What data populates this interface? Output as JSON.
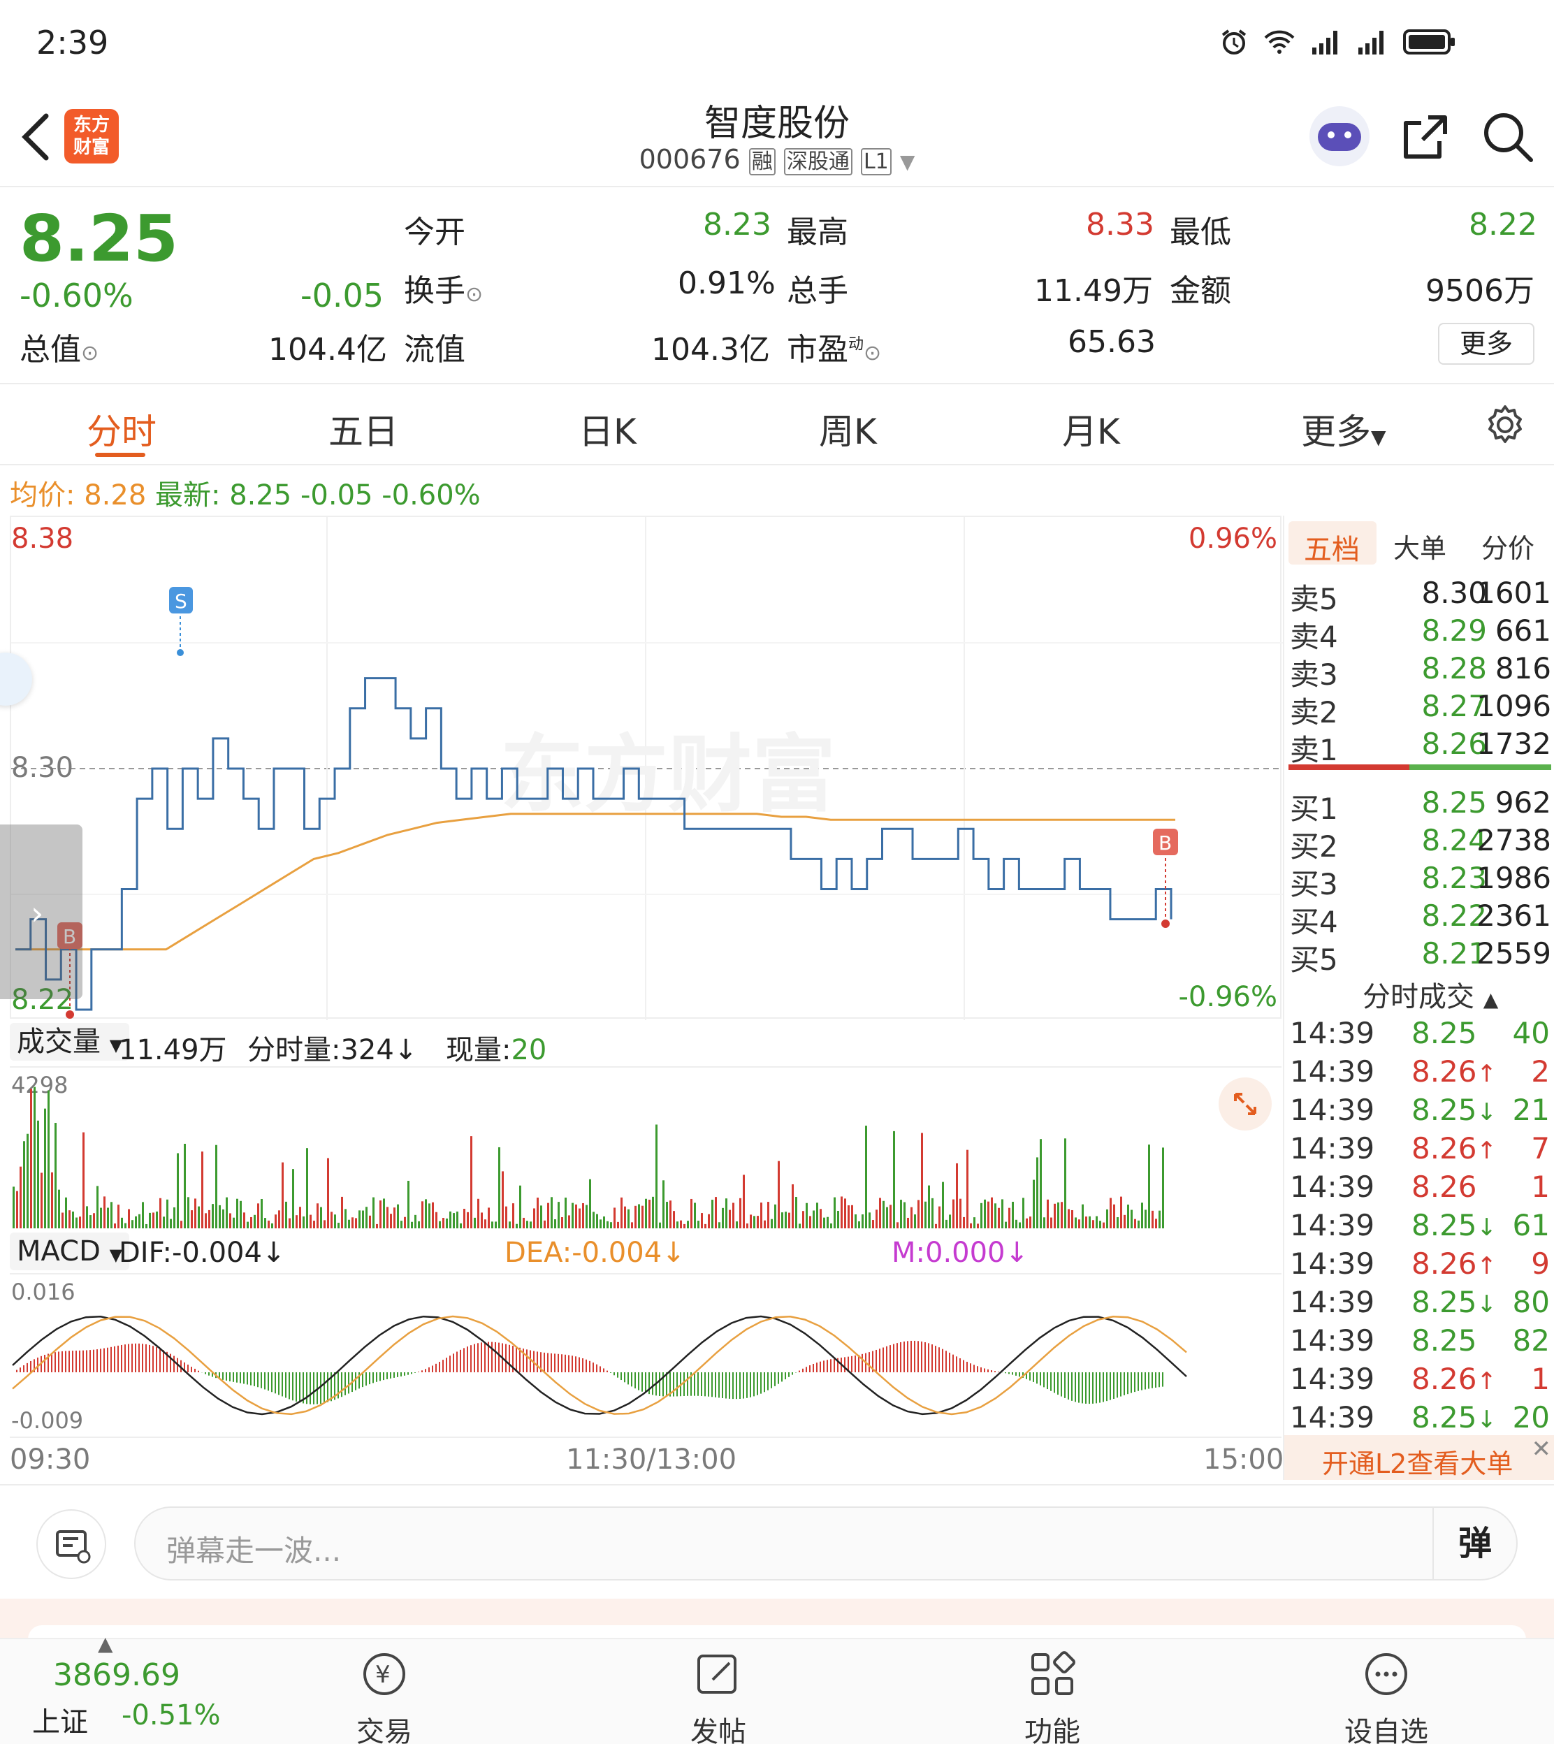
{
  "status": {
    "time": "2:39",
    "icons": [
      "alarm-icon",
      "wifi-icon",
      "signal-icon",
      "signal-icon",
      "battery-icon"
    ]
  },
  "header": {
    "title": "智度股份",
    "code": "000676",
    "tags": [
      "融",
      "深股通",
      "L1"
    ],
    "logo_text": "东方财富"
  },
  "quote": {
    "price": "8.25",
    "change_pct": "-0.60%",
    "change": "-0.05",
    "open_label": "今开",
    "open": "8.23",
    "high_label": "最高",
    "high": "8.33",
    "low_label": "最低",
    "low": "8.22",
    "turnover_label": "换手",
    "turnover": "0.91%",
    "volume_label": "总手",
    "volume": "11.49万",
    "amount_label": "金额",
    "amount": "9506万",
    "mktcap_label": "总值",
    "mktcap": "104.4亿",
    "float_label": "流值",
    "float": "104.3亿",
    "pe_label": "市盈",
    "pe_sup": "动",
    "pe": "65.63",
    "more_label": "更多"
  },
  "tabs": [
    "分时",
    "五日",
    "日K",
    "周K",
    "月K",
    "更多"
  ],
  "chart_info": {
    "avg_label": "均价:",
    "avg": "8.28",
    "latest_label": "最新:",
    "latest": "8.25",
    "change": "-0.05",
    "change_pct": "-0.60%",
    "watermark": "东方财富"
  },
  "chart_data": {
    "type": "line",
    "y_top": "8.38",
    "y_mid": "8.30",
    "y_bottom": "8.22",
    "pct_top": "0.96%",
    "pct_bottom": "-0.96%",
    "x_labels": [
      "09:30",
      "11:30/13:00",
      "15:00"
    ],
    "ylim": [
      8.22,
      8.38
    ],
    "price_series": [
      8.24,
      8.25,
      8.23,
      8.24,
      8.22,
      8.24,
      8.24,
      8.26,
      8.29,
      8.3,
      8.28,
      8.3,
      8.29,
      8.31,
      8.3,
      8.29,
      8.28,
      8.3,
      8.3,
      8.28,
      8.29,
      8.3,
      8.32,
      8.33,
      8.33,
      8.32,
      8.31,
      8.32,
      8.3,
      8.29,
      8.3,
      8.29,
      8.3,
      8.29,
      8.29,
      8.3,
      8.29,
      8.3,
      8.29,
      8.29,
      8.3,
      8.29,
      8.29,
      8.29,
      8.28,
      8.28,
      8.28,
      8.28,
      8.28,
      8.28,
      8.28,
      8.27,
      8.27,
      8.26,
      8.27,
      8.26,
      8.27,
      8.28,
      8.28,
      8.27,
      8.27,
      8.27,
      8.28,
      8.27,
      8.26,
      8.27,
      8.26,
      8.26,
      8.26,
      8.27,
      8.26,
      8.26,
      8.25,
      8.25,
      8.25,
      8.26,
      8.25
    ],
    "avg_series": [
      8.24,
      8.24,
      8.24,
      8.24,
      8.245,
      8.25,
      8.255,
      8.26,
      8.265,
      8.27,
      8.272,
      8.275,
      8.278,
      8.28,
      8.282,
      8.283,
      8.284,
      8.285,
      8.285,
      8.285,
      8.285,
      8.285,
      8.285,
      8.285,
      8.285,
      8.285,
      8.285,
      8.285,
      8.284,
      8.284,
      8.283,
      8.283,
      8.283,
      8.283,
      8.283,
      8.283,
      8.283,
      8.283,
      8.283,
      8.283,
      8.283,
      8.283,
      8.283,
      8.283,
      8.283
    ],
    "markers": [
      "S",
      "B",
      "B"
    ],
    "volume": {
      "label": "成交量",
      "total": "11.49万",
      "tick_label": "分时量:324",
      "current_label": "现量:",
      "current": "20",
      "max": "4298"
    },
    "macd": {
      "label": "MACD",
      "dif": "DIF:-0.004",
      "dea": "DEA:-0.004",
      "m": "M:0.000",
      "ymax": "0.016",
      "ymin": "-0.009"
    }
  },
  "orderbook": {
    "tabs": [
      "五档",
      "大单",
      "分价"
    ],
    "asks": [
      {
        "label": "卖5",
        "price": "8.30",
        "qty": "1601"
      },
      {
        "label": "卖4",
        "price": "8.29",
        "qty": "661"
      },
      {
        "label": "卖3",
        "price": "8.28",
        "qty": "816"
      },
      {
        "label": "卖2",
        "price": "8.27",
        "qty": "1096"
      },
      {
        "label": "卖1",
        "price": "8.26",
        "qty": "1732"
      }
    ],
    "bids": [
      {
        "label": "买1",
        "price": "8.25",
        "qty": "962"
      },
      {
        "label": "买2",
        "price": "8.24",
        "qty": "2738"
      },
      {
        "label": "买3",
        "price": "8.23",
        "qty": "1986"
      },
      {
        "label": "买4",
        "price": "8.22",
        "qty": "2361"
      },
      {
        "label": "买5",
        "price": "8.21",
        "qty": "2559"
      }
    ],
    "ticks_title": "分时成交",
    "ticks": [
      {
        "time": "14:39",
        "price": "8.25",
        "dir": "",
        "qty": "40",
        "color": "green"
      },
      {
        "time": "14:39",
        "price": "8.26",
        "dir": "↑",
        "qty": "2",
        "color": "red"
      },
      {
        "time": "14:39",
        "price": "8.25",
        "dir": "↓",
        "qty": "21",
        "color": "green"
      },
      {
        "time": "14:39",
        "price": "8.26",
        "dir": "↑",
        "qty": "7",
        "color": "red"
      },
      {
        "time": "14:39",
        "price": "8.26",
        "dir": "",
        "qty": "1",
        "color": "red"
      },
      {
        "time": "14:39",
        "price": "8.25",
        "dir": "↓",
        "qty": "61",
        "color": "green"
      },
      {
        "time": "14:39",
        "price": "8.26",
        "dir": "↑",
        "qty": "9",
        "color": "red"
      },
      {
        "time": "14:39",
        "price": "8.25",
        "dir": "↓",
        "qty": "80",
        "color": "green"
      },
      {
        "time": "14:39",
        "price": "8.25",
        "dir": "",
        "qty": "82",
        "color": "green"
      },
      {
        "time": "14:39",
        "price": "8.26",
        "dir": "↑",
        "qty": "1",
        "color": "red"
      },
      {
        "time": "14:39",
        "price": "8.25",
        "dir": "↓",
        "qty": "20",
        "color": "green"
      }
    ],
    "l2_banner": "开通L2查看大单"
  },
  "comment": {
    "placeholder": "弹幕走一波...",
    "danmu": "弹"
  },
  "bottom_nav": {
    "index_value": "3869.69",
    "index_name": "上证",
    "index_change": "-0.51%",
    "items": [
      "交易",
      "发帖",
      "功能",
      "设自选"
    ]
  }
}
